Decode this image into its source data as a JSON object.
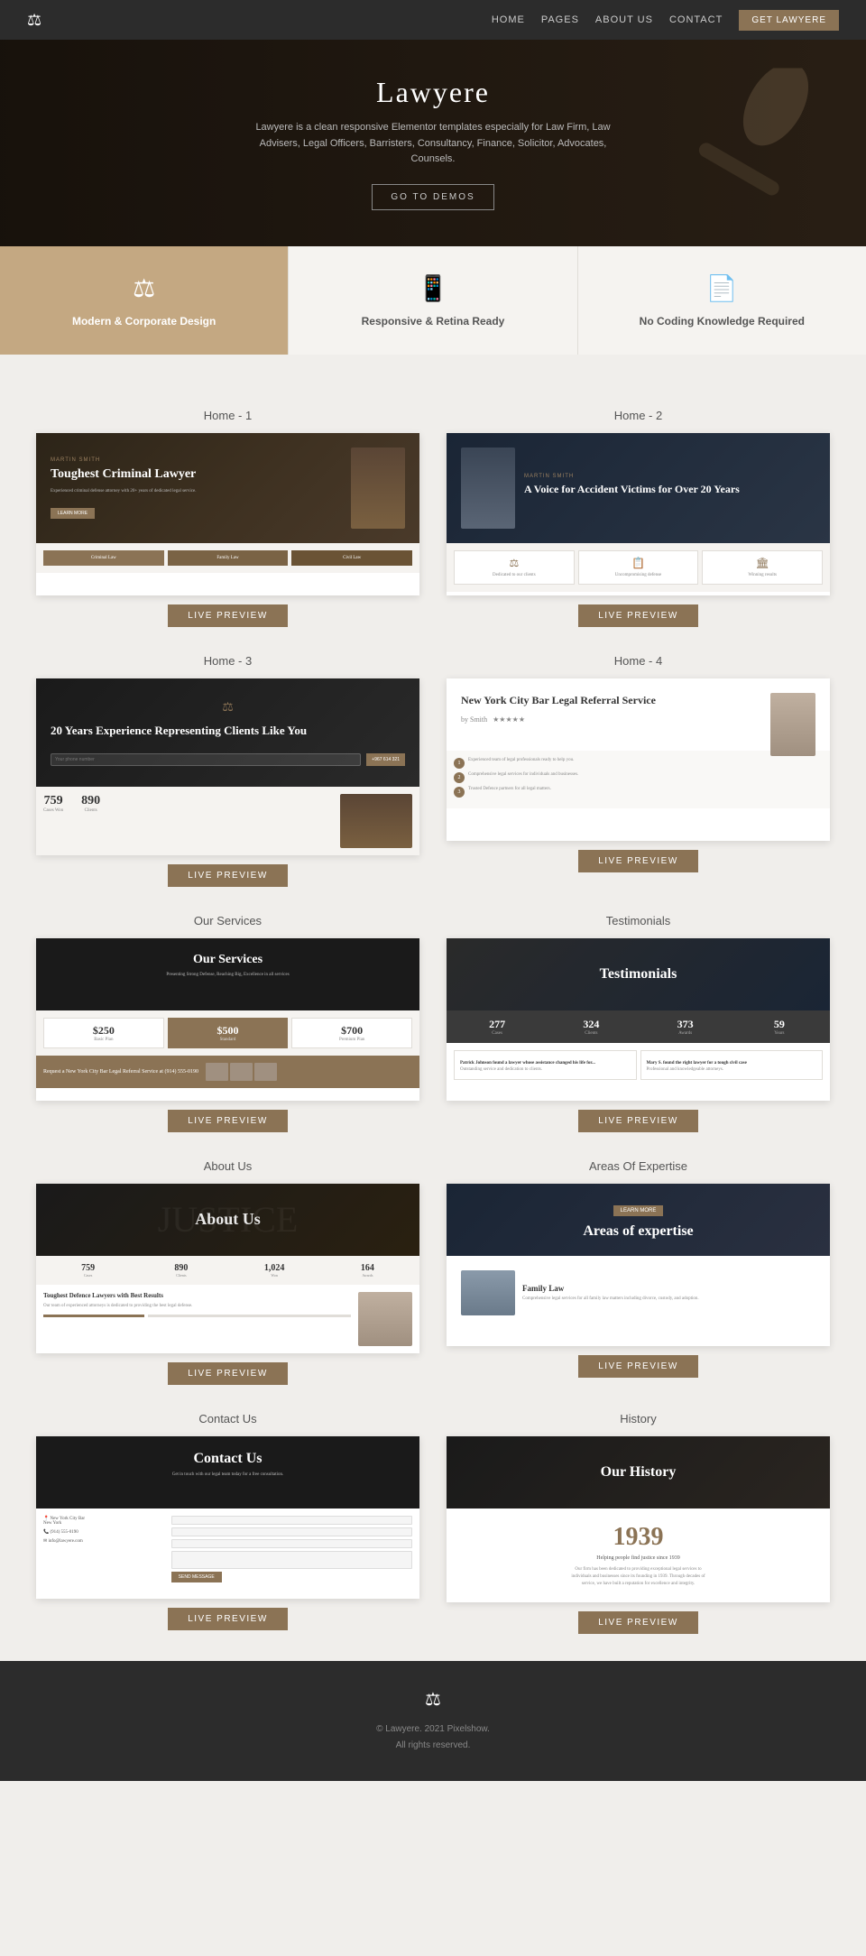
{
  "nav": {
    "logo_icon": "⚖",
    "links": [
      {
        "label": "HOME",
        "has_dropdown": true
      },
      {
        "label": "PAGES",
        "has_dropdown": true
      },
      {
        "label": "ABOUT US"
      },
      {
        "label": "CONTACT"
      }
    ],
    "cta_label": "GET LAWYERE"
  },
  "hero": {
    "title": "Lawyere",
    "subtitle": "Lawyere is a clean responsive Elementor templates especially for Law Firm, Law Advisers, Legal Officers, Barristers, Consultancy, Finance, Solicitor, Advocates, Counsels.",
    "cta_label": "GO TO DEMOS"
  },
  "features": [
    {
      "id": "modern-corporate",
      "icon": "⚖",
      "title": "Modern & Corporate Design",
      "accent": true
    },
    {
      "id": "responsive-retina",
      "icon": "📱",
      "title": "Responsive & Retina Ready",
      "accent": false
    },
    {
      "id": "no-coding",
      "icon": "📄",
      "title": "No Coding Knowledge Required",
      "accent": false
    }
  ],
  "demos": [
    {
      "id": "home-1",
      "label": "Home - 1",
      "preview_tag": "Martin Smith",
      "preview_title": "Toughest Criminal Lawyer",
      "preview_cta": "LIVE PREVIEW"
    },
    {
      "id": "home-2",
      "label": "Home - 2",
      "preview_tag": "Martin Smith",
      "preview_title": "A Voice for Accident Victims for Over 20 Years",
      "preview_cta": "LIVE PREVIEW"
    },
    {
      "id": "home-3",
      "label": "Home - 3",
      "preview_title": "20 Years Experience Representing Clients Like You",
      "preview_cta": "LIVE PREVIEW"
    },
    {
      "id": "home-4",
      "label": "Home - 4",
      "preview_title": "New York City Bar Legal Referral Service",
      "preview_cta": "LIVE PREVIEW"
    },
    {
      "id": "our-services",
      "label": "Our Services",
      "preview_title": "Our Services",
      "preview_cta": "LIVE PREVIEW"
    },
    {
      "id": "testimonials",
      "label": "Testimonials",
      "preview_title": "Testimonials",
      "preview_cta": "LIVE PREVIEW"
    },
    {
      "id": "about-us",
      "label": "About Us",
      "preview_title": "About Us",
      "preview_cta": "LIVE PREVIEW"
    },
    {
      "id": "areas-of-expertise",
      "label": "Areas Of Expertise",
      "preview_title": "Areas of expertise",
      "preview_cta": "LIVE PREVIEW"
    },
    {
      "id": "contact-us",
      "label": "Contact Us",
      "preview_title": "Contact Us",
      "preview_cta": "LIVE PREVIEW"
    },
    {
      "id": "history",
      "label": "History",
      "preview_title": "Our History",
      "preview_year": "1939",
      "preview_subtitle": "Helping people find justice since 1939",
      "preview_cta": "LIVE PREVIEW"
    }
  ],
  "footer": {
    "logo_icon": "⚖",
    "copyright": "© Lawyere. 2021 Pixelshow.",
    "rights": "All rights reserved."
  }
}
